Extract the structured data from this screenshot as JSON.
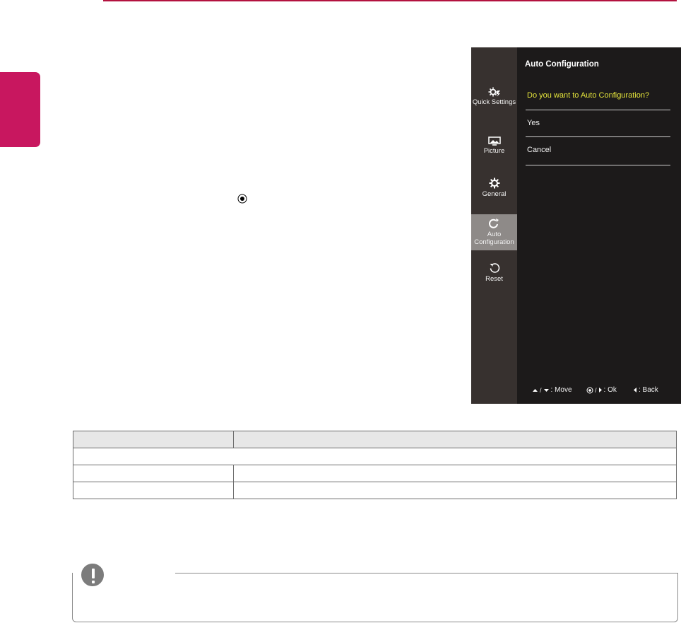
{
  "page": {
    "accent_color": "#c8175f",
    "rule_color": "#b3123f"
  },
  "ok_button_symbol": "ok-joystick-icon",
  "osd": {
    "sidebar_items": [
      {
        "label": "Quick Settings",
        "icon": "quick-settings-icon",
        "active": false
      },
      {
        "label": "Picture",
        "icon": "picture-icon",
        "active": false
      },
      {
        "label": "General",
        "icon": "gear-icon",
        "active": false
      },
      {
        "label": "Auto Configuration",
        "icon": "auto-configuration-icon",
        "active": true
      },
      {
        "label": "Reset",
        "icon": "reset-icon",
        "active": false
      }
    ],
    "title": "Auto Configuration",
    "question": "Do you want to Auto Configuration?",
    "options": [
      "Yes",
      "Cancel"
    ],
    "footer": {
      "move": ": Move",
      "ok": ": Ok",
      "back": ": Back"
    },
    "colors": {
      "background": "#1c1a1a",
      "sidebar": "#37312f",
      "active_item": "#8e8a88",
      "question": "#e6e63c"
    }
  },
  "table": {
    "rows": 4,
    "header_color": "#e7e7e7"
  },
  "note": {
    "icon": "exclamation-note-icon"
  }
}
